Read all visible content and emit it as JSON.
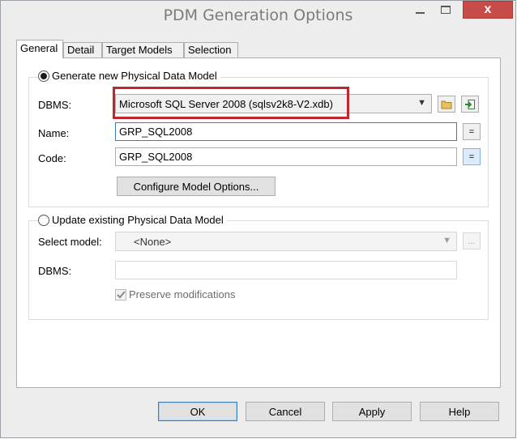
{
  "window": {
    "title": "PDM Generation Options",
    "close_glyph": "x"
  },
  "tabs": [
    {
      "label": "General"
    },
    {
      "label": "Detail"
    },
    {
      "label": "Target Models"
    },
    {
      "label": "Selection"
    }
  ],
  "generate_new": {
    "radio_label": "Generate new Physical Data Model",
    "selected": true,
    "dbms_label": "DBMS:",
    "dbms_value": "Microsoft SQL Server 2008 (sqlsv2k8-V2.xdb)",
    "name_label": "Name:",
    "name_value": "GRP_SQL2008",
    "code_label": "Code:",
    "code_value": "GRP_SQL2008",
    "equals_glyph": "=",
    "configure_button": "Configure Model Options..."
  },
  "update_existing": {
    "radio_label": "Update existing Physical Data Model",
    "selected": false,
    "select_model_label": "Select model:",
    "select_model_value": "<None>",
    "browse_glyph": "...",
    "dbms_label": "DBMS:",
    "dbms_value": "",
    "preserve_label": "Preserve modifications",
    "preserve_checked": true
  },
  "buttons": {
    "ok": "OK",
    "cancel": "Cancel",
    "apply": "Apply",
    "help": "Help"
  },
  "colors": {
    "highlight": "#c0272d",
    "close_button": "#c74b46"
  }
}
